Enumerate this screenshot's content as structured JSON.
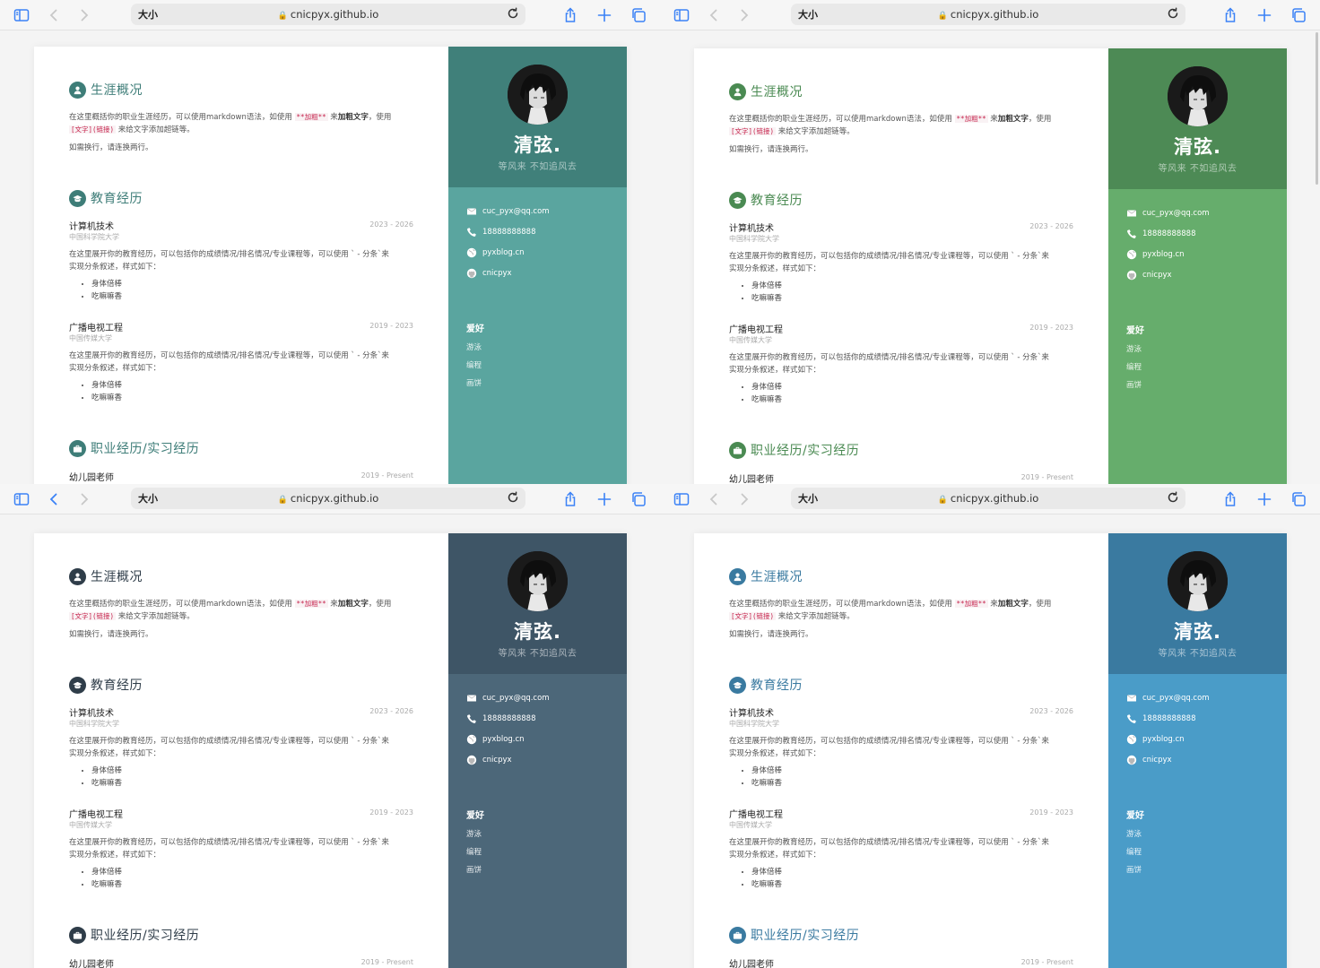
{
  "browser": {
    "reader_label": "大小",
    "url": "cnicpyx.github.io"
  },
  "resume": {
    "name": "清弦.",
    "motto": "等风来 不如追风去",
    "contacts": [
      {
        "icon": "envelope-icon",
        "text": "cuc_pyx@qq.com"
      },
      {
        "icon": "phone-icon",
        "text": "18888888888"
      },
      {
        "icon": "globe-icon",
        "text": "pyxblog.cn"
      },
      {
        "icon": "github-icon",
        "text": "cnicpyx"
      }
    ],
    "hobbies_title": "爱好",
    "hobbies": [
      "游泳",
      "编程",
      "画饼"
    ],
    "summary": {
      "title": "生涯概况",
      "line1_a": "在这里概括你的职业生涯经历，可以使用markdown语法，如使用 ",
      "line1_code": "**加粗**",
      "line1_b": " 来",
      "line1_bold": "加粗文字",
      "line1_c": "，使用",
      "line2_code": "[文字](链接)",
      "line2_b": " 来给文字添加超链等。",
      "line3": "如需换行，请连换两行。"
    },
    "education": {
      "title": "教育经历",
      "entries": [
        {
          "major": "计算机技术",
          "school": "中国科学院大学",
          "date": "2023 - 2026",
          "desc1": "在这里展开你的教育经历，可以包括你的成绩情况/排名情况/专业课程等，可以使用 ` - 分条`来",
          "desc2": "实现分条叙述，样式如下：",
          "bullets": [
            "身体倍棒",
            "吃嘛嘛香"
          ]
        },
        {
          "major": "广播电视工程",
          "school": "中国传媒大学",
          "date": "2019 - 2023",
          "desc1": "在这里展开你的教育经历，可以包括你的成绩情况/排名情况/专业课程等，可以使用 ` - 分条`来",
          "desc2": "实现分条叙述，样式如下：",
          "bullets": [
            "身体倍棒",
            "吃嘛嘛香"
          ]
        }
      ]
    },
    "work": {
      "title": "职业经历/实习经历",
      "entries": [
        {
          "role": "幼儿园老师",
          "date": "2019 - Present"
        }
      ]
    }
  },
  "variants": [
    {
      "theme": "teal",
      "top_color": "#40807a",
      "bottom_color": "#5aa59f",
      "icon_color": "#3e7d78",
      "back_enabled": false
    },
    {
      "theme": "green",
      "top_color": "#4d8a55",
      "bottom_color": "#66ad6c",
      "icon_color": "#4a8a52",
      "back_enabled": false
    },
    {
      "theme": "slate",
      "top_color": "#3e5566",
      "bottom_color": "#4c6779",
      "icon_color": "#2f3d49",
      "back_enabled": true
    },
    {
      "theme": "blue",
      "top_color": "#3a7aa0",
      "bottom_color": "#4a9cc8",
      "icon_color": "#3a7aa0",
      "back_enabled": false
    }
  ]
}
